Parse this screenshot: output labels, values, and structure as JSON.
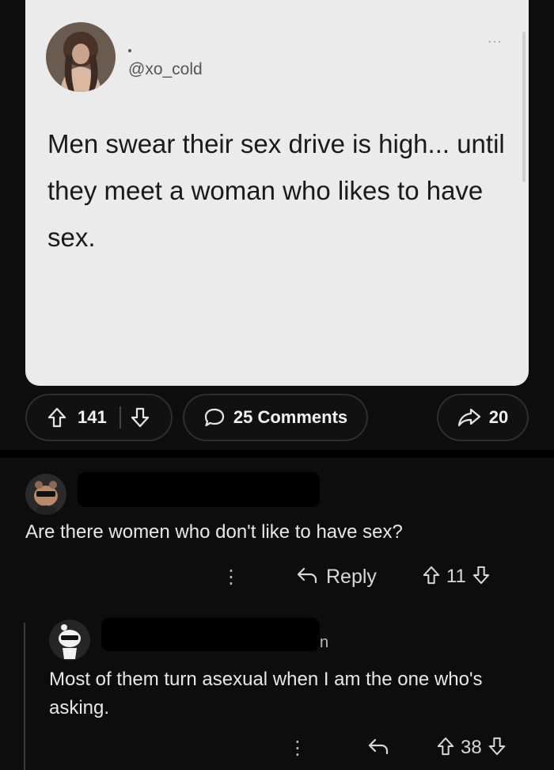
{
  "tweet": {
    "handle": "@xo_cold",
    "more": "···",
    "text": "Men swear their sex drive is high... until they meet a woman who likes to have sex."
  },
  "post_actions": {
    "upvotes": "141",
    "comments_label": "25 Comments",
    "shares": "20"
  },
  "comments": [
    {
      "text": "Are there women who don't like to have sex?",
      "reply_label": "Reply",
      "score": "11"
    },
    {
      "username_tail": "n",
      "text": "Most of them turn asexual when I am the one who's asking.",
      "score": "38"
    }
  ],
  "colors": {
    "background": "#0d0d0d",
    "card": "#ebebeb",
    "pill_border": "#2e2e2e"
  }
}
